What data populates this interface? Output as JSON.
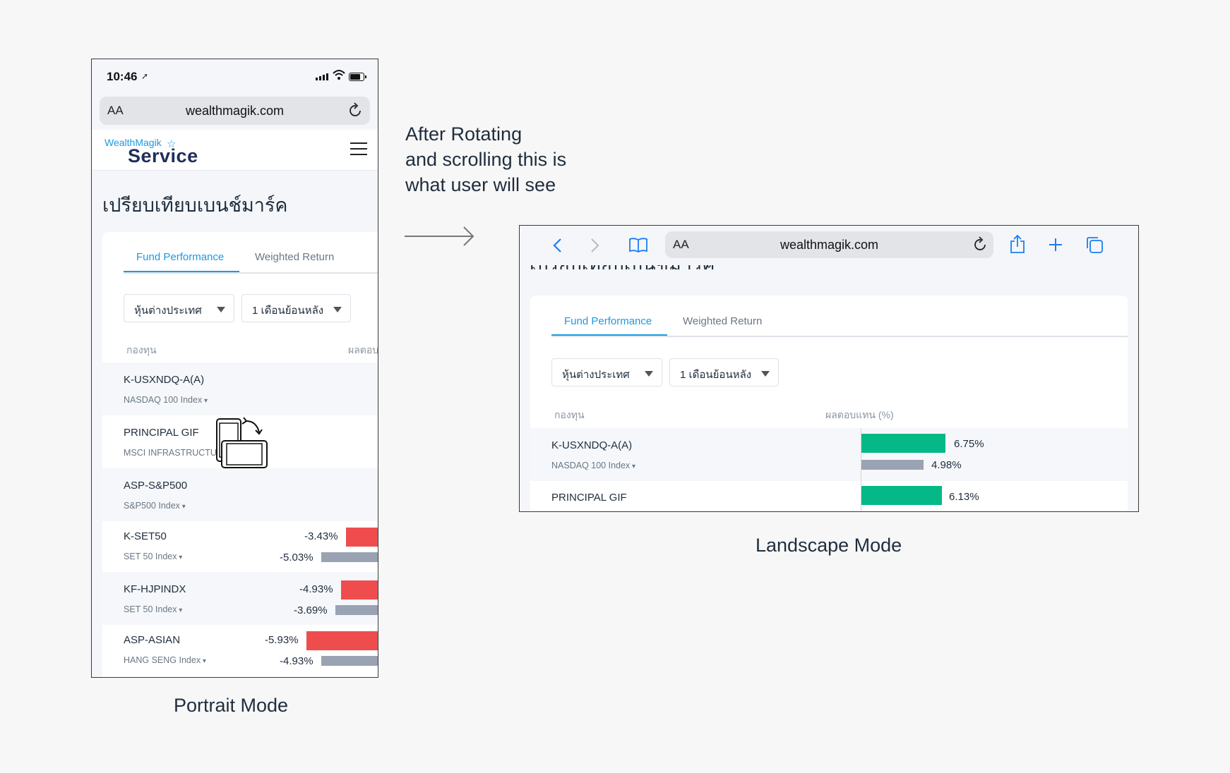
{
  "portrait": {
    "status_time": "10:46",
    "url_aa": "AA",
    "url": "wealthmagik.com",
    "logo_small": "WealthMagik",
    "logo_big": "Service",
    "page_title": "เปรียบเทียบเบนช์มาร์ค",
    "tabs": [
      "Fund Performance",
      "Weighted Return"
    ],
    "select_category": "หุ้นต่างประเทศ",
    "select_period": "1 เดือนย้อนหลัง",
    "col_fund": "กองทุน",
    "col_return": "ผลตอบ",
    "rows": [
      {
        "name": "K-USXNDQ-A(A)",
        "index": "NASDAQ 100 Index",
        "fund_return": "",
        "index_return": ""
      },
      {
        "name": "PRINCIPAL GIF",
        "index": "MSCI INFRASTRUCTU",
        "fund_return": "",
        "index_return": ""
      },
      {
        "name": "ASP-S&P500",
        "index": "S&P500 Index",
        "fund_return": "",
        "index_return": ""
      },
      {
        "name": "K-SET50",
        "index": "SET 50 Index",
        "fund_return": "-3.43%",
        "index_return": "-5.03%"
      },
      {
        "name": "KF-HJPINDX",
        "index": "SET 50 Index",
        "fund_return": "-4.93%",
        "index_return": "-3.69%"
      },
      {
        "name": "ASP-ASIAN",
        "index": "HANG SENG Index",
        "fund_return": "-5.93%",
        "index_return": "-4.93%"
      }
    ],
    "caption": "Portrait Mode"
  },
  "note": {
    "line1": "After Rotating",
    "line2": "and scrolling this is",
    "line3": "what user will see"
  },
  "landscape": {
    "url_aa": "AA",
    "url": "wealthmagik.com",
    "page_title_clipped": "เปรียบเทียบเบนช์มาร์ค",
    "tabs": [
      "Fund Performance",
      "Weighted Return"
    ],
    "select_category": "หุ้นต่างประเทศ",
    "select_period": "1 เดือนย้อนหลัง",
    "col_fund": "กองทุน",
    "col_return": "ผลตอบแทน (%)",
    "rows": [
      {
        "name": "K-USXNDQ-A(A)",
        "index": "NASDAQ 100 Index",
        "fund_return": "6.75%",
        "index_return": "4.98%"
      },
      {
        "name": "PRINCIPAL GIF",
        "index": "",
        "fund_return": "6.13%",
        "index_return": ""
      }
    ],
    "caption": "Landscape Mode"
  },
  "colors": {
    "accent": "#1a9be0",
    "negative": "#ef4d4d",
    "positive": "#05b887",
    "benchmark": "#9aa3b3"
  }
}
